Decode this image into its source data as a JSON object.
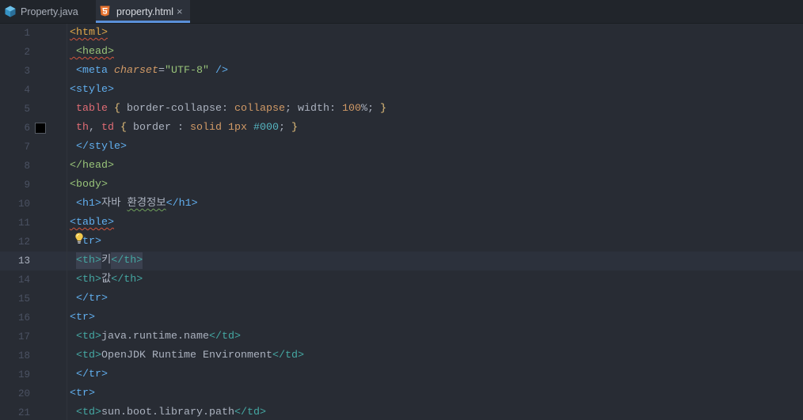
{
  "theme": {
    "editor_bg": "#282c34",
    "current_line_bg": "#2c313c",
    "tabbar_bg": "#21252b",
    "active_tab_bg": "#2c313a",
    "tab_underline": "#5a8fd8"
  },
  "tabs": [
    {
      "label": "Property.java",
      "icon": "java-class-icon",
      "active": false
    },
    {
      "label": "property.html",
      "icon": "html5-icon",
      "active": true,
      "close_label": "×"
    }
  ],
  "editor": {
    "lines": [
      {
        "number": 1,
        "tokens": [
          {
            "text": "<html>",
            "color": "#e0a84a",
            "squiggle": "#d0543c"
          }
        ]
      },
      {
        "number": 2,
        "tokens": [
          {
            "text": " <head>",
            "color": "#98c379",
            "squiggle": "#d0543c"
          }
        ]
      },
      {
        "number": 3,
        "tokens": [
          {
            "text": " "
          },
          {
            "text": "<meta",
            "color": "#61afef"
          },
          {
            "text": " "
          },
          {
            "text": "charset",
            "color": "#d19a66",
            "italic": true
          },
          {
            "text": "=",
            "color": "#abb2bf"
          },
          {
            "text": "\"UTF-8\"",
            "color": "#98c379"
          },
          {
            "text": " "
          },
          {
            "text": "/>",
            "color": "#61afef"
          }
        ]
      },
      {
        "number": 4,
        "tokens": [
          {
            "text": "<style>",
            "color": "#61afef"
          }
        ]
      },
      {
        "number": 5,
        "tokens": [
          {
            "text": " "
          },
          {
            "text": "table",
            "color": "#e06c75"
          },
          {
            "text": " "
          },
          {
            "text": "{",
            "color": "#e5c07b"
          },
          {
            "text": " border-collapse: ",
            "color": "#abb2bf"
          },
          {
            "text": "collapse",
            "color": "#d19a66"
          },
          {
            "text": "; width: ",
            "color": "#abb2bf"
          },
          {
            "text": "100",
            "color": "#d19a66"
          },
          {
            "text": "%; ",
            "color": "#abb2bf"
          },
          {
            "text": "}",
            "color": "#e5c07b"
          }
        ]
      },
      {
        "number": 6,
        "swatch": "#000000",
        "tokens": [
          {
            "text": " "
          },
          {
            "text": "th",
            "color": "#e06c75"
          },
          {
            "text": ", ",
            "color": "#abb2bf"
          },
          {
            "text": "td",
            "color": "#e06c75"
          },
          {
            "text": " "
          },
          {
            "text": "{",
            "color": "#e5c07b"
          },
          {
            "text": " border : ",
            "color": "#abb2bf"
          },
          {
            "text": "solid",
            "color": "#d19a66"
          },
          {
            "text": " "
          },
          {
            "text": "1px",
            "color": "#d19a66"
          },
          {
            "text": " "
          },
          {
            "text": "#000",
            "color": "#56b6c2"
          },
          {
            "text": "; ",
            "color": "#abb2bf"
          },
          {
            "text": "}",
            "color": "#e5c07b"
          }
        ]
      },
      {
        "number": 7,
        "tokens": [
          {
            "text": " "
          },
          {
            "text": "</style>",
            "color": "#61afef"
          }
        ]
      },
      {
        "number": 8,
        "tokens": [
          {
            "text": "</head>",
            "color": "#98c379"
          }
        ]
      },
      {
        "number": 9,
        "tokens": [
          {
            "text": "<body>",
            "color": "#98c379"
          }
        ]
      },
      {
        "number": 10,
        "tokens": [
          {
            "text": " "
          },
          {
            "text": "<h1>",
            "color": "#61afef"
          },
          {
            "text": "자바 ",
            "color": "#abb2bf"
          },
          {
            "text": "환경정보",
            "color": "#abb2bf",
            "squiggle": "#6f9f5a"
          },
          {
            "text": "</h1>",
            "color": "#61afef"
          }
        ]
      },
      {
        "number": 11,
        "tokens": [
          {
            "text": "<table>",
            "color": "#61afef",
            "squiggle": "#d0543c"
          }
        ]
      },
      {
        "number": 12,
        "tokens": [
          {
            "text": " "
          },
          {
            "icon": "lightbulb-icon"
          },
          {
            "text": "tr>",
            "color": "#61afef"
          }
        ]
      },
      {
        "number": 13,
        "current": true,
        "tokens": [
          {
            "text": " "
          },
          {
            "text": "<th>",
            "color": "#45a8a3",
            "match": true
          },
          {
            "text": "키",
            "color": "#abb2bf"
          },
          {
            "text": "</th>",
            "color": "#45a8a3",
            "match": true
          }
        ]
      },
      {
        "number": 14,
        "tokens": [
          {
            "text": " "
          },
          {
            "text": "<th>",
            "color": "#45a8a3"
          },
          {
            "text": "값",
            "color": "#abb2bf"
          },
          {
            "text": "</th>",
            "color": "#45a8a3"
          }
        ]
      },
      {
        "number": 15,
        "tokens": [
          {
            "text": " "
          },
          {
            "text": "</tr>",
            "color": "#61afef"
          }
        ]
      },
      {
        "number": 16,
        "tokens": [
          {
            "text": "<tr>",
            "color": "#61afef"
          }
        ]
      },
      {
        "number": 17,
        "tokens": [
          {
            "text": " "
          },
          {
            "text": "<td>",
            "color": "#45a8a3"
          },
          {
            "text": "java.runtime.name",
            "color": "#abb2bf"
          },
          {
            "text": "</td>",
            "color": "#45a8a3"
          }
        ]
      },
      {
        "number": 18,
        "tokens": [
          {
            "text": " "
          },
          {
            "text": "<td>",
            "color": "#45a8a3"
          },
          {
            "text": "OpenJDK Runtime Environment",
            "color": "#abb2bf"
          },
          {
            "text": "</td>",
            "color": "#45a8a3"
          }
        ]
      },
      {
        "number": 19,
        "tokens": [
          {
            "text": " "
          },
          {
            "text": "</tr>",
            "color": "#61afef"
          }
        ]
      },
      {
        "number": 20,
        "tokens": [
          {
            "text": "<tr>",
            "color": "#61afef"
          }
        ]
      },
      {
        "number": 21,
        "tokens": [
          {
            "text": " "
          },
          {
            "text": "<td>",
            "color": "#45a8a3"
          },
          {
            "text": "sun.boot.library.path",
            "color": "#abb2bf"
          },
          {
            "text": "</td>",
            "color": "#45a8a3"
          }
        ]
      }
    ]
  }
}
